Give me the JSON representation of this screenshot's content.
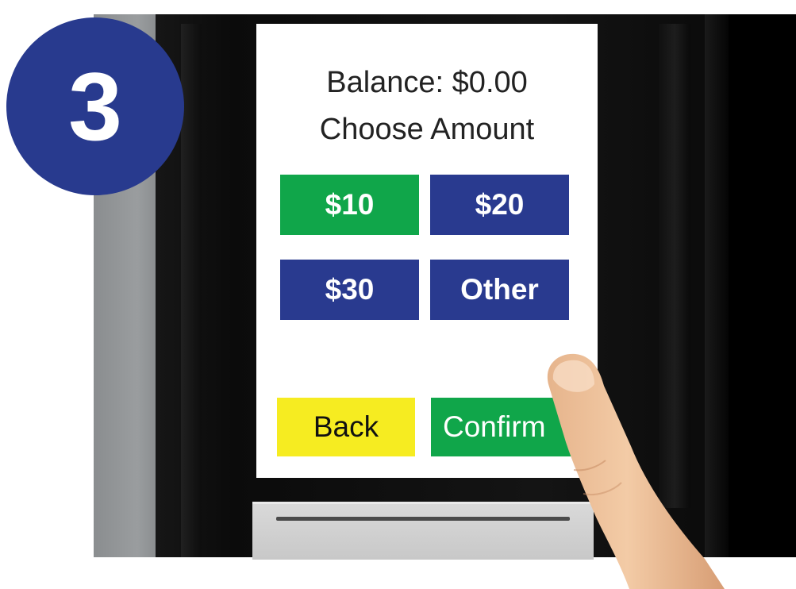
{
  "step_badge": {
    "number": "3"
  },
  "screen": {
    "balance_label": "Balance: $0.00",
    "prompt": "Choose Amount",
    "amount_buttons": [
      {
        "label": "$10",
        "color": "#10a64a"
      },
      {
        "label": "$20",
        "color": "#293a8f"
      },
      {
        "label": "$30",
        "color": "#293a8f"
      },
      {
        "label": "Other",
        "color": "#293a8f"
      }
    ],
    "back_button": {
      "label": "Back",
      "color": "#f6ec21"
    },
    "confirm_button": {
      "label": "Confirm",
      "color": "#10a64a"
    }
  },
  "colors": {
    "badge": "#283a8e",
    "kiosk_body": "#0b0b0b",
    "kiosk_side": "#9a9d9f",
    "card_slot": "#d0d0d0"
  }
}
